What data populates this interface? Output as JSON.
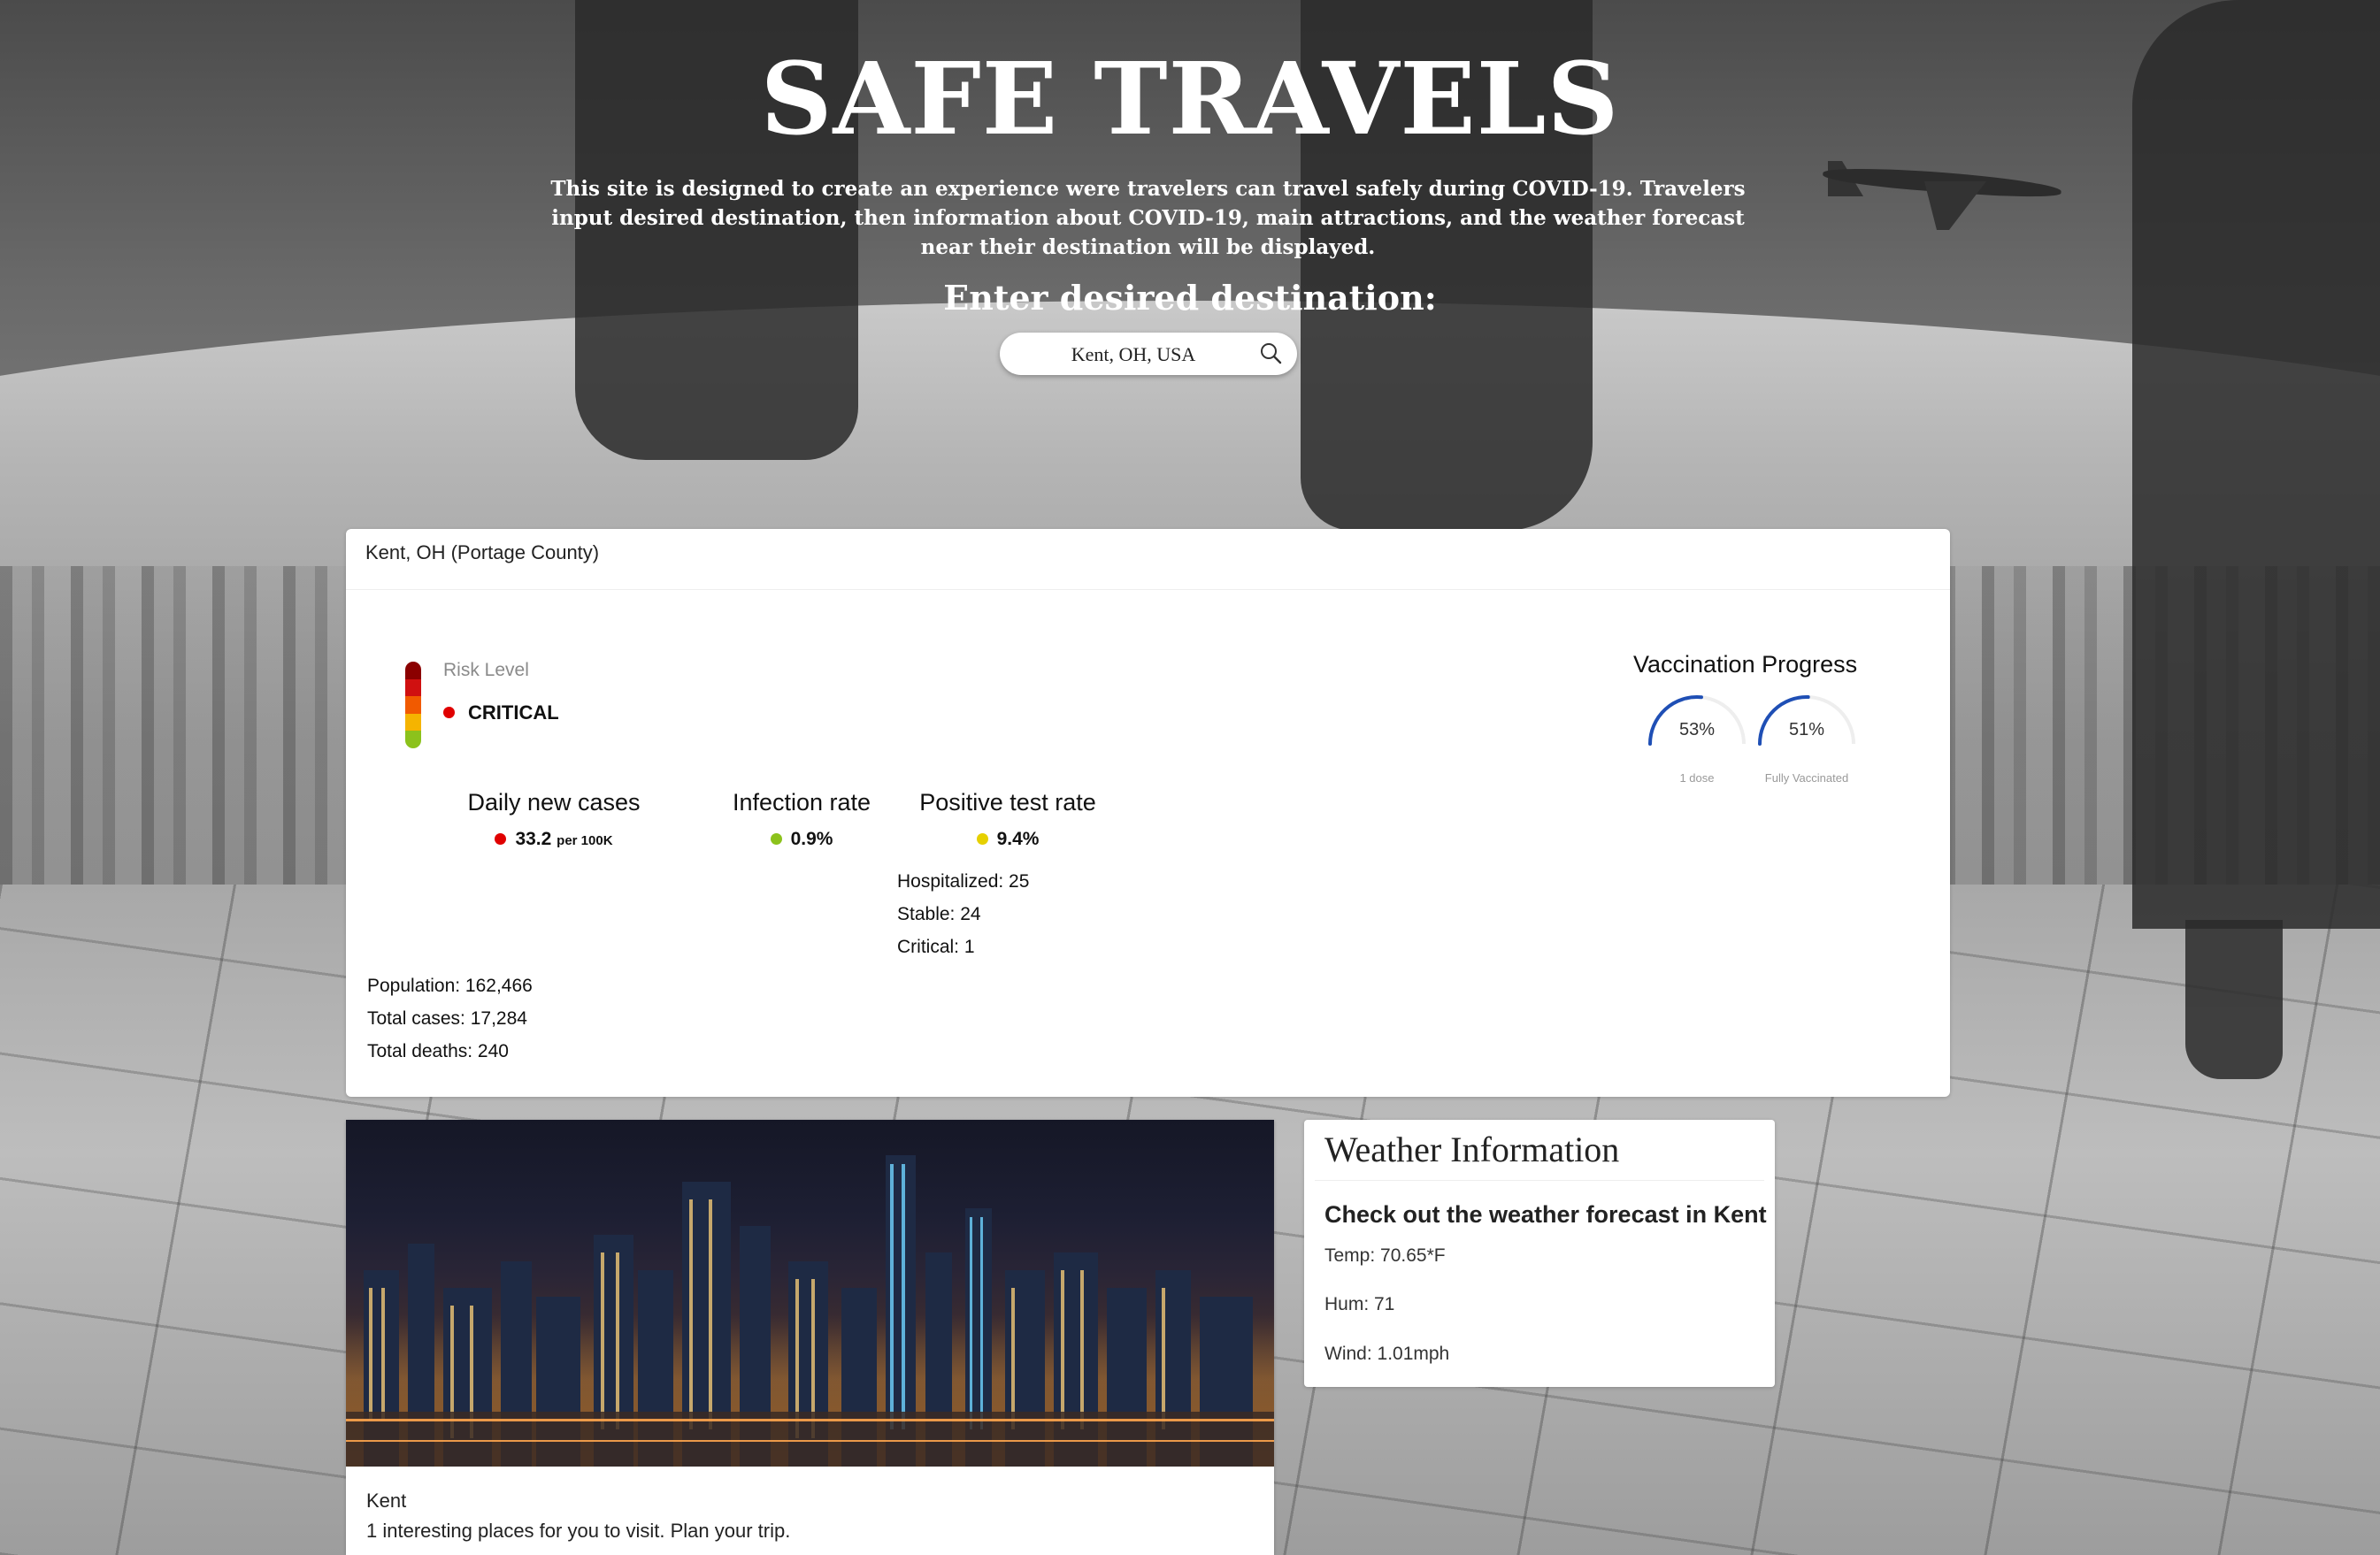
{
  "header": {
    "title": "SAFE TRAVELS",
    "description": "This site is designed to create an experience were travelers can travel safely during COVID-19. Travelers input desired destination, then information about COVID-19, main attractions, and the weather forecast near their destination will be displayed.",
    "prompt": "Enter desired destination:"
  },
  "search": {
    "value": "Kent, OH, USA",
    "icon": "search-icon"
  },
  "covid": {
    "location": "Kent, OH (Portage County)",
    "risk": {
      "label": "Risk Level",
      "value": "CRITICAL",
      "color": "#e00000",
      "scale_colors": [
        "#8b0000",
        "#d01010",
        "#f15a00",
        "#f5b400",
        "#8cc21c"
      ]
    },
    "metrics": [
      {
        "title": "Daily new cases",
        "value": "33.2",
        "unit": "per 100K",
        "color": "#e00000"
      },
      {
        "title": "Infection rate",
        "value": "0.9%",
        "color": "#8cc21c"
      },
      {
        "title": "Positive test rate",
        "value": "9.4%",
        "color": "#e6d000"
      }
    ],
    "hospital": {
      "hospitalized": "Hospitalized: 25",
      "stable": "Stable: 24",
      "critical": "Critical: 1"
    },
    "totals": {
      "population": "Population: 162,466",
      "cases": "Total cases: 17,284",
      "deaths": "Total deaths: 240"
    },
    "vaccination": {
      "title": "Vaccination Progress",
      "gauges": [
        {
          "percent": "53%",
          "fraction": 0.53,
          "label": "1 dose"
        },
        {
          "percent": "51%",
          "fraction": 0.51,
          "label": "Fully Vaccinated"
        }
      ],
      "color": "#1f4fb5"
    }
  },
  "attractions": {
    "name": "Kent",
    "subtitle": "1 interesting places for you to visit. Plan your trip."
  },
  "weather": {
    "title": "Weather Information",
    "subtitle": "Check out the weather forecast in Kent",
    "temp": "Temp: 70.65*F",
    "hum": "Hum: 71",
    "wind": "Wind: 1.01mph"
  }
}
